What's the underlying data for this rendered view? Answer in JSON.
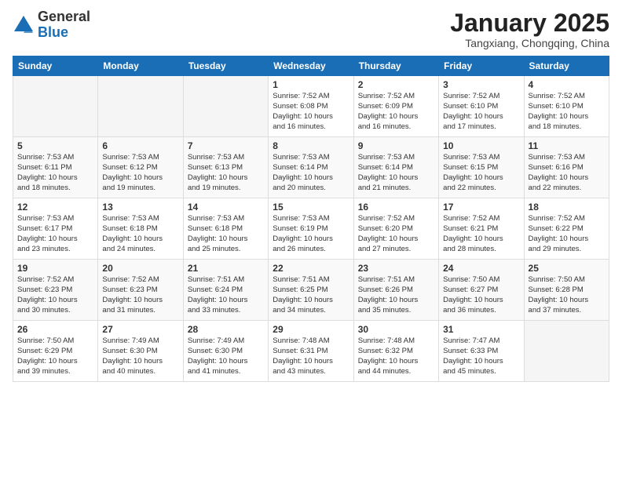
{
  "logo": {
    "general": "General",
    "blue": "Blue"
  },
  "title": "January 2025",
  "location": "Tangxiang, Chongqing, China",
  "days_of_week": [
    "Sunday",
    "Monday",
    "Tuesday",
    "Wednesday",
    "Thursday",
    "Friday",
    "Saturday"
  ],
  "weeks": [
    [
      {
        "num": "",
        "info": ""
      },
      {
        "num": "",
        "info": ""
      },
      {
        "num": "",
        "info": ""
      },
      {
        "num": "1",
        "info": "Sunrise: 7:52 AM\nSunset: 6:08 PM\nDaylight: 10 hours\nand 16 minutes."
      },
      {
        "num": "2",
        "info": "Sunrise: 7:52 AM\nSunset: 6:09 PM\nDaylight: 10 hours\nand 16 minutes."
      },
      {
        "num": "3",
        "info": "Sunrise: 7:52 AM\nSunset: 6:10 PM\nDaylight: 10 hours\nand 17 minutes."
      },
      {
        "num": "4",
        "info": "Sunrise: 7:52 AM\nSunset: 6:10 PM\nDaylight: 10 hours\nand 18 minutes."
      }
    ],
    [
      {
        "num": "5",
        "info": "Sunrise: 7:53 AM\nSunset: 6:11 PM\nDaylight: 10 hours\nand 18 minutes."
      },
      {
        "num": "6",
        "info": "Sunrise: 7:53 AM\nSunset: 6:12 PM\nDaylight: 10 hours\nand 19 minutes."
      },
      {
        "num": "7",
        "info": "Sunrise: 7:53 AM\nSunset: 6:13 PM\nDaylight: 10 hours\nand 19 minutes."
      },
      {
        "num": "8",
        "info": "Sunrise: 7:53 AM\nSunset: 6:14 PM\nDaylight: 10 hours\nand 20 minutes."
      },
      {
        "num": "9",
        "info": "Sunrise: 7:53 AM\nSunset: 6:14 PM\nDaylight: 10 hours\nand 21 minutes."
      },
      {
        "num": "10",
        "info": "Sunrise: 7:53 AM\nSunset: 6:15 PM\nDaylight: 10 hours\nand 22 minutes."
      },
      {
        "num": "11",
        "info": "Sunrise: 7:53 AM\nSunset: 6:16 PM\nDaylight: 10 hours\nand 22 minutes."
      }
    ],
    [
      {
        "num": "12",
        "info": "Sunrise: 7:53 AM\nSunset: 6:17 PM\nDaylight: 10 hours\nand 23 minutes."
      },
      {
        "num": "13",
        "info": "Sunrise: 7:53 AM\nSunset: 6:18 PM\nDaylight: 10 hours\nand 24 minutes."
      },
      {
        "num": "14",
        "info": "Sunrise: 7:53 AM\nSunset: 6:18 PM\nDaylight: 10 hours\nand 25 minutes."
      },
      {
        "num": "15",
        "info": "Sunrise: 7:53 AM\nSunset: 6:19 PM\nDaylight: 10 hours\nand 26 minutes."
      },
      {
        "num": "16",
        "info": "Sunrise: 7:52 AM\nSunset: 6:20 PM\nDaylight: 10 hours\nand 27 minutes."
      },
      {
        "num": "17",
        "info": "Sunrise: 7:52 AM\nSunset: 6:21 PM\nDaylight: 10 hours\nand 28 minutes."
      },
      {
        "num": "18",
        "info": "Sunrise: 7:52 AM\nSunset: 6:22 PM\nDaylight: 10 hours\nand 29 minutes."
      }
    ],
    [
      {
        "num": "19",
        "info": "Sunrise: 7:52 AM\nSunset: 6:23 PM\nDaylight: 10 hours\nand 30 minutes."
      },
      {
        "num": "20",
        "info": "Sunrise: 7:52 AM\nSunset: 6:23 PM\nDaylight: 10 hours\nand 31 minutes."
      },
      {
        "num": "21",
        "info": "Sunrise: 7:51 AM\nSunset: 6:24 PM\nDaylight: 10 hours\nand 33 minutes."
      },
      {
        "num": "22",
        "info": "Sunrise: 7:51 AM\nSunset: 6:25 PM\nDaylight: 10 hours\nand 34 minutes."
      },
      {
        "num": "23",
        "info": "Sunrise: 7:51 AM\nSunset: 6:26 PM\nDaylight: 10 hours\nand 35 minutes."
      },
      {
        "num": "24",
        "info": "Sunrise: 7:50 AM\nSunset: 6:27 PM\nDaylight: 10 hours\nand 36 minutes."
      },
      {
        "num": "25",
        "info": "Sunrise: 7:50 AM\nSunset: 6:28 PM\nDaylight: 10 hours\nand 37 minutes."
      }
    ],
    [
      {
        "num": "26",
        "info": "Sunrise: 7:50 AM\nSunset: 6:29 PM\nDaylight: 10 hours\nand 39 minutes."
      },
      {
        "num": "27",
        "info": "Sunrise: 7:49 AM\nSunset: 6:30 PM\nDaylight: 10 hours\nand 40 minutes."
      },
      {
        "num": "28",
        "info": "Sunrise: 7:49 AM\nSunset: 6:30 PM\nDaylight: 10 hours\nand 41 minutes."
      },
      {
        "num": "29",
        "info": "Sunrise: 7:48 AM\nSunset: 6:31 PM\nDaylight: 10 hours\nand 43 minutes."
      },
      {
        "num": "30",
        "info": "Sunrise: 7:48 AM\nSunset: 6:32 PM\nDaylight: 10 hours\nand 44 minutes."
      },
      {
        "num": "31",
        "info": "Sunrise: 7:47 AM\nSunset: 6:33 PM\nDaylight: 10 hours\nand 45 minutes."
      },
      {
        "num": "",
        "info": ""
      }
    ]
  ]
}
